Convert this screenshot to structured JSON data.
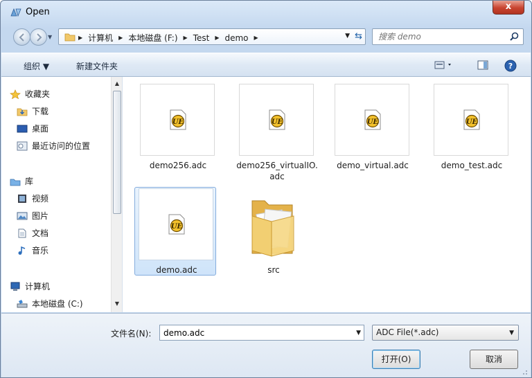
{
  "window": {
    "title": "Open",
    "close_label": "x"
  },
  "address": {
    "crumbs": [
      "计算机",
      "本地磁盘 (F:)",
      "Test",
      "demo"
    ]
  },
  "search": {
    "placeholder": "搜索 demo"
  },
  "toolbar": {
    "organize": "组织 ▼",
    "new_folder": "新建文件夹"
  },
  "sidebar": {
    "favorites": "收藏夹",
    "downloads": "下载",
    "desktop": "桌面",
    "recent": "最近访问的位置",
    "libraries": "库",
    "videos": "视频",
    "pictures": "图片",
    "documents": "文档",
    "music": "音乐",
    "computer": "计算机",
    "local_disk_c": "本地磁盘 (C:)"
  },
  "files": [
    {
      "name": "demo256.adc",
      "icon": "ultraedit-icon"
    },
    {
      "name": "demo256_virtualIO.adc",
      "icon": "ultraedit-icon"
    },
    {
      "name": "demo_virtual.adc",
      "icon": "ultraedit-icon"
    },
    {
      "name": "demo_test.adc",
      "icon": "ultraedit-icon"
    },
    {
      "name": "demo.adc",
      "icon": "ultraedit-icon",
      "selected": true
    },
    {
      "name": "src",
      "icon": "folder-icon"
    }
  ],
  "footer": {
    "filename_label": "文件名(N):",
    "filename_value": "demo.adc",
    "filetype_value": "ADC File(*.adc)",
    "open_label": "打开(O)",
    "cancel_label": "取消"
  },
  "colors": {
    "accent": "#1c5fa8",
    "selection": "#cfe4fa"
  }
}
